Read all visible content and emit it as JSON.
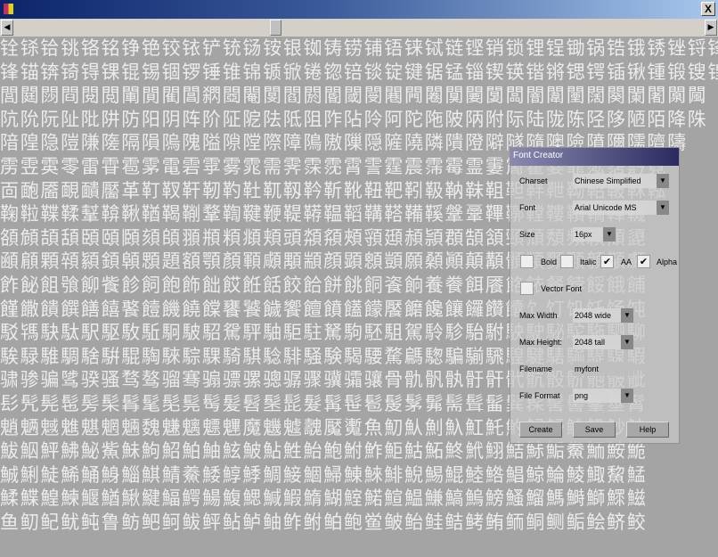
{
  "window": {
    "close_label": "X"
  },
  "scrollbar": {
    "left_arrow": "◀",
    "right_arrow": "▶",
    "position": 0.38
  },
  "glyph_rows": [
    "铨铩铪铫铬铭铮铯铰铱铲铳铴铵银铷铸铹铺铻铼铽链铿销锁锂锃锄锅锆锇锈锉锊锋锌锎锏",
    "锋锚锛锜锝锞锟锡锢锣锤锥锦锧锨锩锪锫锬锭键锯锰锱锲锳锴锵锶锷锸锹锺锻锼锽锾",
    "閭閮閯閰閱閲閳閴閵閶閷閸閹閺閻閼閽閾閿闀闁闂闃闄闅闆闇闈闉闊闋闌闍闎闏",
    "阬阭阮阯阰阱防阳阴阵阶阷阸阹阺阻阼阽阾阿陀陁陂陃附际陆陇陈陉陊陋陌降陎",
    "隌隍隐隑隒隓隔隕隖隗隘隙隚際障隝隞隟隠隡隢隣隤隥隦隧隨隩險隫隬隭隮隯",
    "雳雴雵零雷雸雹雺電雼雽雾雿需霁霂霃霄霅霆震霈霉霊霋霌霍霎霏霐霑霒霓",
    "靣靤靥靦靧靨革靪靫靬靭靮靯靰靱靲靳靴靵靶靷靸靹靺靻靼靽靾靿鞀鞁鞂鞃",
    "鞠鞡鞢鞣鞤鞥鞦鞧鞨鞩鞪鞫鞬鞭鞮鞯鞰鞱鞲鞳鞴鞵鞶鞷鞸鞹鞺鞻鞼鞽鞾鞿",
    "頟頠頡頢頣頤頥頦頧頨頩頪頫頬頭頮頯頰頱頲頳頴頵頶頷頸頹頺頻頼頽頾",
    "顄顅顆顇顈顉顊顋題額顎顏顐顑顒顓顔顕顖顗願顙顚顛顜顝類顟顠顡顢顣",
    "飵飶飷飸飹飺飻飼飽飾飿餀餁餂餃餄餅餆餇餈餉養餋餌餍餎餏餐餑餒餓餔",
    "饉饊饋饌饍饎饏饐饑饒饓饔饕饖饗饘饙饚饛饜饝饞饟饠饡饢饣饤饥饦饧饨",
    "駁駂駃駄駅駆駇駈駉駊駋駌駍駎駏駐駑駒駓駔駕駖駗駘駙駚駛駜駝駞駟駠",
    "騃騄騅騆騇騈騉騊騋騌騍騎騏騐騑騒験騔騕騖騗騘騙騚騛騜騝騞騟騠騡騢",
    "骕骖骗骘骙骚骛骜骝骞骟骠骡骢骣骤骥骦骧骨骩骪骫骬骭骮骯骰骱骲骳骴",
    "髟髠髡髢髣髤髥髦髧髨髩髪髫髬髭髮髯髰髱髲髳髴髵髶髷髸髹髺髻髼髽髾",
    "魈魉魊魋魌魍魎魏魐魑魒魓魔魕魖魗魘魙魚魛魜魝魞魟魠魡魢魣魤魥魦魧",
    "鮁鮂鮃鮄鮅鮆鮇鮈鮉鮊鮋鮌鮍鮎鮏鮐鮑鮒鮓鮔鮕鮖鮗鮘鮙鮚鮛鮜鮝鮞鮟鮠",
    "鯎鯏鯐鯑鯒鯓鯔鯕鯖鯗鯘鯙鯚鯛鯜鯝鯞鯟鯠鯡鯢鯣鯤鯥鯦鯧鯨鯩鯪鯫鯬鯭",
    "鰇鰈鰉鰊鰋鰌鰍鰎鰏鰐鰑鰒鰓鰔鰕鰖鰗鰘鰙鰚鰛鰜鰝鰞鰟鰠鰡鰢鰣鰤鰥鰦",
    "鱼鱽鱾鱿鲀鲁鲂鲃鲄鲅鲆鲇鲈鲉鲊鲋鲌鲍鲎鲏鲐鲑鲒鲓鲔鲕鲖鲗鲘鲙鲚鲛"
  ],
  "dialog": {
    "title": "Font Creator",
    "charset": {
      "label": "Charset",
      "value": "Chinese Simplified"
    },
    "font": {
      "label": "Font",
      "value": "Arial Unicode MS"
    },
    "size": {
      "label": "Size",
      "value": "16px"
    },
    "bold": {
      "label": "Bold",
      "checked": false
    },
    "italic": {
      "label": "Italic",
      "checked": false
    },
    "aa": {
      "label": "AA",
      "checked": true
    },
    "alpha": {
      "label": "Alpha",
      "checked": true
    },
    "vector": {
      "label": "Vector Font",
      "checked": false
    },
    "max_width": {
      "label": "Max Width",
      "value": "2048 wide"
    },
    "max_height": {
      "label": "Max Height:",
      "value": "2048 tall"
    },
    "filename": {
      "label": "Filename",
      "value": "myfont"
    },
    "file_format": {
      "label": "File Format",
      "value": "png"
    },
    "create_label": "Create",
    "save_label": "Save",
    "help_label": "Help",
    "check_glyph": "✔",
    "dropdown_glyph": "▼"
  }
}
